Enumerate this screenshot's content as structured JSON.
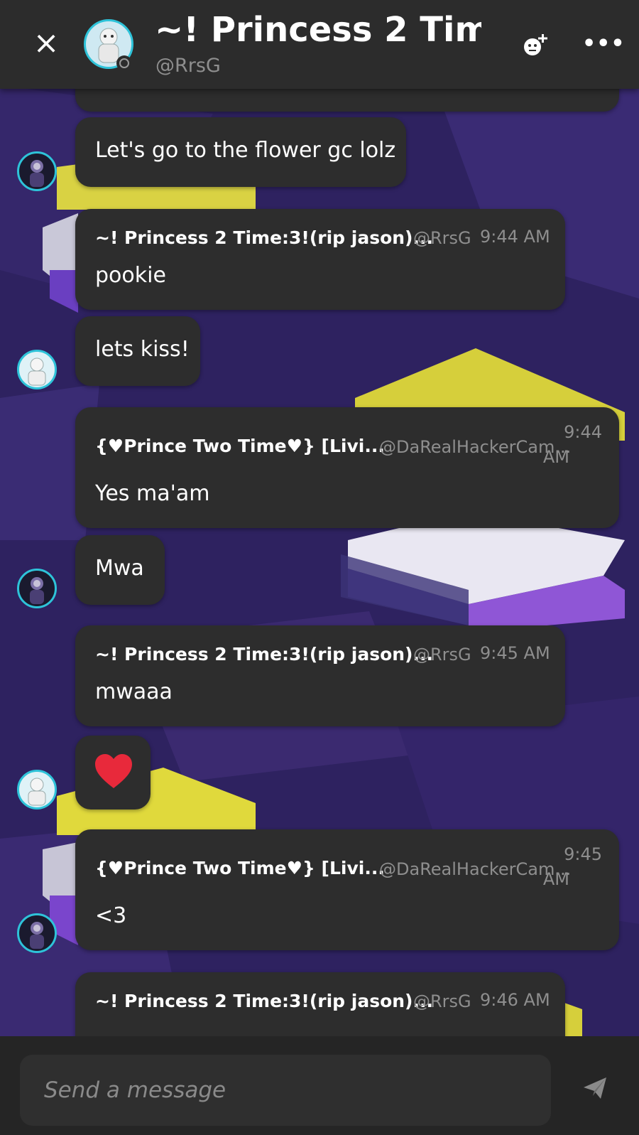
{
  "header": {
    "title": "~! Princess 2 Tim...",
    "handle": "@RrsG",
    "close_icon": "×",
    "more_icon": "•••"
  },
  "messages": [
    {
      "type": "text",
      "text": "Let's go to the flower gc lolz"
    },
    {
      "type": "full",
      "sender": "~! Princess 2 Time:3!(rip jason)...",
      "handle": "@RrsG",
      "time": "9:44 AM",
      "text": "pookie"
    },
    {
      "type": "text",
      "text": "lets kiss!"
    },
    {
      "type": "full",
      "sender": "{♥Prince Two Time♥} [Livi...",
      "handle": "@DaRealHackerCam...",
      "time_line1": "9:44",
      "time_line2": "AM",
      "text": "Yes ma'am"
    },
    {
      "type": "text",
      "text": "Mwa"
    },
    {
      "type": "full",
      "sender": "~! Princess 2 Time:3!(rip jason)...",
      "handle": "@RrsG",
      "time": "9:45 AM",
      "text": "mwaaa"
    },
    {
      "type": "emoji",
      "emoji": "heart-icon"
    },
    {
      "type": "full",
      "sender": "{♥Prince Two Time♥} [Livi...",
      "handle": "@DaRealHackerCam...",
      "time_line1": "9:45",
      "time_line2": "AM",
      "text": "<3"
    },
    {
      "type": "full",
      "sender": "~! Princess 2 Time:3!(rip jason)...",
      "handle": "@RrsG",
      "time": "9:46 AM"
    }
  ],
  "composer": {
    "placeholder": "Send a message"
  },
  "colors": {
    "header_bg": "#2c2c2c",
    "bubble_bg": "#2d2d2d",
    "accent": "#2ec3d9",
    "heart": "#e8293b"
  }
}
